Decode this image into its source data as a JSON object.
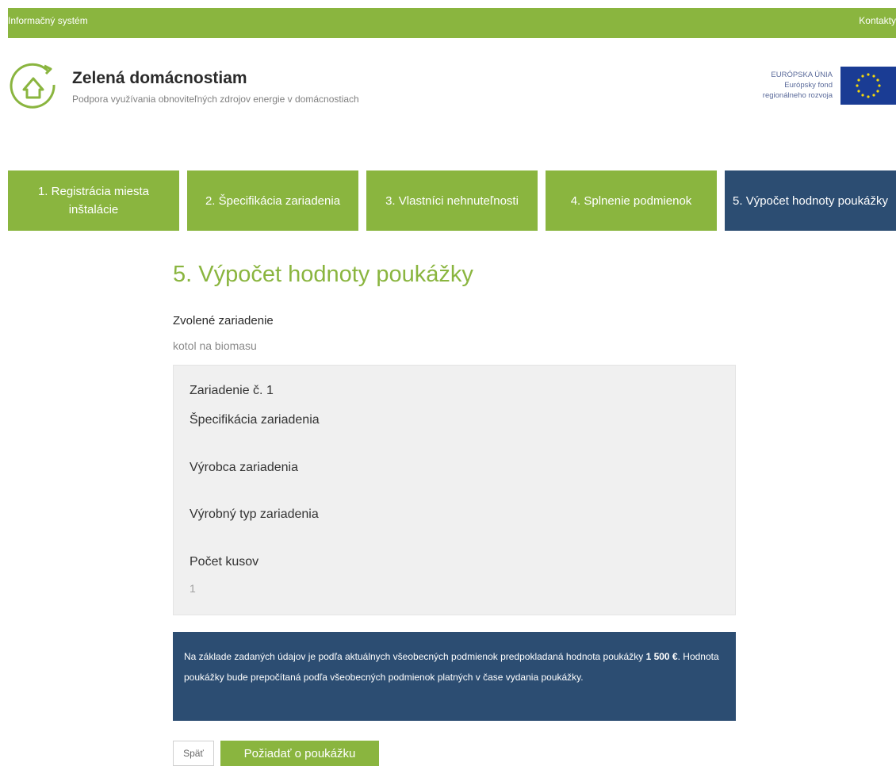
{
  "topbar": {
    "left_link": "Informačný systém",
    "right_link": "Kontakty"
  },
  "brand": {
    "logo_icon": "green-house-recycle-logo",
    "title": "Zelená domácnostiam",
    "subtitle": "Podpora využívania obnoviteľných zdrojov energie v domácnostiach"
  },
  "eu": {
    "line1": "EURÓPSKA ÚNIA",
    "line2": "Európsky fond",
    "line3": "regionálneho rozvoja",
    "flag_icon": "eu-flag-icon"
  },
  "steps": [
    {
      "label": "1. Registrácia miesta inštalácie",
      "active": false
    },
    {
      "label": "2. Špecifikácia zariadenia",
      "active": false
    },
    {
      "label": "3. Vlastníci nehnuteľnosti",
      "active": false
    },
    {
      "label": "4. Splnenie podmienok",
      "active": false
    },
    {
      "label": "5. Výpočet hodnoty poukážky",
      "active": true
    }
  ],
  "main": {
    "title": "5. Výpočet hodnoty poukážky",
    "selected_device_label": "Zvolené zariadenie",
    "selected_device_value": "kotol na biomasu"
  },
  "device": {
    "heading": "Zariadenie č. 1",
    "spec_label": "Špecifikácia zariadenia",
    "spec_value": "",
    "manufacturer_label": "Výrobca zariadenia",
    "manufacturer_value": "",
    "type_label": "Výrobný typ zariadenia",
    "type_value": "",
    "count_label": "Počet kusov",
    "count_value": "1"
  },
  "info": {
    "text_before": "Na základe zadaných údajov je podľa aktuálnych všeobecných podmienok predpokladaná hodnota poukážky ",
    "amount": "1 500 €",
    "text_after": ". Hodnota poukážky bude prepočítaná podľa všeobecných podmienok platných v čase vydania poukážky."
  },
  "buttons": {
    "back": "Späť",
    "request": "Požiadať o poukážku"
  },
  "colors": {
    "green": "#8ab53f",
    "dark_blue": "#2c4d72",
    "panel_grey": "#f0f0f0"
  }
}
